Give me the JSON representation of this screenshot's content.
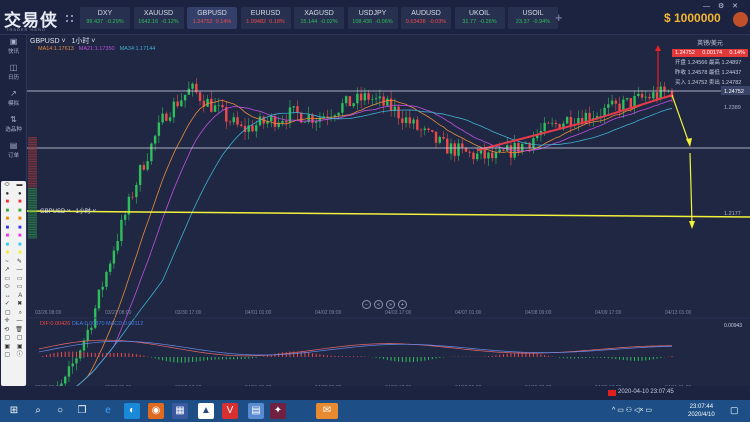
{
  "app": {
    "logo": "交易侠",
    "logo_sub": "TRADER HERO",
    "balance": "$ 1000000",
    "window_controls": "— ⚙ ✕"
  },
  "tickers": [
    {
      "symbol": "DXY",
      "value": "99.437",
      "change": "-0.29%",
      "dir": "up"
    },
    {
      "symbol": "XAUUSD",
      "value": "1642.16",
      "change": "-0.12%",
      "dir": "up"
    },
    {
      "symbol": "GBPUSD",
      "value": "1.24752",
      "change": "0.14%",
      "dir": "dn"
    },
    {
      "symbol": "EURUSD",
      "value": "1.09482",
      "change": "0.18%",
      "dir": "dn"
    },
    {
      "symbol": "XAGUSD",
      "value": "15.144",
      "change": "-0.02%",
      "dir": "up"
    },
    {
      "symbol": "USDJPY",
      "value": "108.436",
      "change": "-0.06%",
      "dir": "up"
    },
    {
      "symbol": "AUDUSD",
      "value": "0.63438",
      "change": "-0.03%",
      "dir": "dn"
    },
    {
      "symbol": "UKOIL",
      "value": "31.77",
      "change": "-0.26%",
      "dir": "up"
    },
    {
      "symbol": "USOIL",
      "value": "23.37",
      "change": "-0.94%",
      "dir": "up"
    }
  ],
  "sidebar": [
    {
      "label": "快讯",
      "icon": "news-icon"
    },
    {
      "label": "日历",
      "icon": "calendar-icon"
    },
    {
      "label": "模拟",
      "icon": "simulate-icon"
    },
    {
      "label": "选品种",
      "icon": "swap-icon"
    },
    {
      "label": "订单",
      "icon": "order-icon"
    }
  ],
  "chart": {
    "symbol": "GBPUSD",
    "timeframe": "1小时",
    "ma": [
      {
        "label": "MA14:1.17613",
        "color": "#e88a3a"
      },
      {
        "label": "MA21:1.17350",
        "color": "#c050e0"
      },
      {
        "label": "MA34:1.17144",
        "color": "#40b0d0"
      }
    ],
    "sub_symbol": "GBPUSD",
    "sub_timeframe": "1小时",
    "price_labels": [
      "1.24752",
      "1.2389",
      "1.2177"
    ],
    "last_price": "1.24752",
    "price_path": [
      1.17,
      1.176,
      1.19,
      1.21,
      1.228,
      1.242,
      1.248,
      1.243,
      1.238,
      1.24,
      1.242,
      1.241,
      1.244,
      1.246,
      1.243,
      1.238,
      1.234,
      1.232,
      1.231,
      1.234,
      1.238,
      1.241,
      1.242,
      1.244,
      1.246,
      1.2475
    ],
    "x_labels": [
      "03/26 08:00",
      "03/27 08:00",
      "03/30 17:00",
      "04/01 01:00",
      "04/02 09:00",
      "04/03 17:00",
      "04/07 01:00",
      "04/08 09:00",
      "04/09 17:00",
      "04/13 01:00"
    ],
    "bottom_labels": [
      "03/26 09:00",
      "03/27 09:00",
      "03/30 17:00",
      "04/01 01:00",
      "04/02 09:00",
      "04/03 17:00",
      "04/07 01:00",
      "04/08 09:00",
      "04/09 17:00",
      "04/11 01:00"
    ],
    "colors": {
      "up": "#2fbf5a",
      "down": "#ef4a4a",
      "hline": "#d8dce8",
      "trend": "#f2f23a"
    }
  },
  "macd": {
    "dif": "DIF:0.00426",
    "dea": "DEA:0.00370 MACD:0.00112",
    "scale": "0.00943"
  },
  "quote": {
    "title": "英镑/美元",
    "last": "1.24752",
    "change": "0.00174",
    "pct": "0.14%",
    "rows": [
      "开盘 1.24566  最高 1.24897",
      "昨收 1.24578  最低 1.24437",
      "买入 1.24752  卖出 1.24782"
    ]
  },
  "status": {
    "datetime": "2020-04-10 23:07:45"
  },
  "taskbar": {
    "time": "23:07:44",
    "date": "2020/4/10"
  }
}
